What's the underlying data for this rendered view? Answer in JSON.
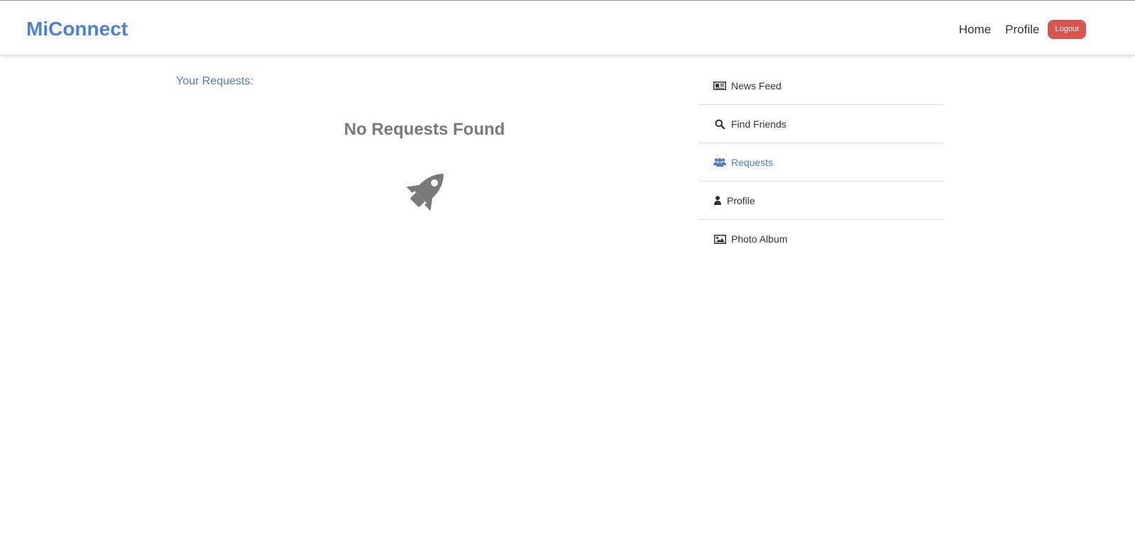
{
  "brand": "MiConnect",
  "nav": {
    "home": "Home",
    "profile": "Profile",
    "logout": "Logout"
  },
  "main": {
    "heading": "Your Requests:",
    "empty_message": "No Requests Found",
    "empty_icon": "rocket-icon"
  },
  "sidebar": {
    "items": [
      {
        "label": "News Feed",
        "icon": "newspaper-icon",
        "active": false
      },
      {
        "label": "Find Friends",
        "icon": "search-icon",
        "active": false
      },
      {
        "label": "Requests",
        "icon": "users-icon",
        "active": true
      },
      {
        "label": "Profile",
        "icon": "user-icon",
        "active": false
      },
      {
        "label": "Photo Album",
        "icon": "image-icon",
        "active": false
      }
    ]
  },
  "colors": {
    "brand": "#4a80e0",
    "accent": "#4a7cc7",
    "logout": "#d9534f",
    "muted": "#7a7a7a"
  }
}
